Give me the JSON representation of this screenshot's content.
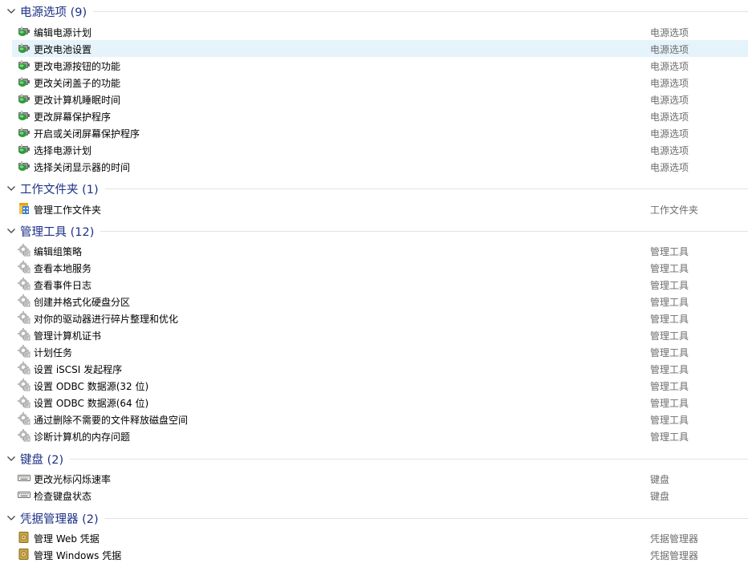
{
  "colors": {
    "header_text": "#1e3287",
    "item_text": "#000000",
    "category_text": "#6d6d6d",
    "selected_bg": "#e5f3fb",
    "divider": "#e3e3e3"
  },
  "groups": [
    {
      "title": "电源选项 (9)",
      "icon": "power-icon",
      "items": [
        {
          "label": "编辑电源计划",
          "category": "电源选项"
        },
        {
          "label": "更改电池设置",
          "category": "电源选项",
          "selected": true
        },
        {
          "label": "更改电源按钮的功能",
          "category": "电源选项"
        },
        {
          "label": "更改关闭盖子的功能",
          "category": "电源选项"
        },
        {
          "label": "更改计算机睡眠时间",
          "category": "电源选项"
        },
        {
          "label": "更改屏幕保护程序",
          "category": "电源选项"
        },
        {
          "label": "开启或关闭屏幕保护程序",
          "category": "电源选项"
        },
        {
          "label": "选择电源计划",
          "category": "电源选项"
        },
        {
          "label": "选择关闭显示器的时间",
          "category": "电源选项"
        }
      ]
    },
    {
      "title": "工作文件夹 (1)",
      "icon": "work-folders-icon",
      "items": [
        {
          "label": "管理工作文件夹",
          "category": "工作文件夹"
        }
      ]
    },
    {
      "title": "管理工具 (12)",
      "icon": "admin-tools-icon",
      "items": [
        {
          "label": "编辑组策略",
          "category": "管理工具"
        },
        {
          "label": "查看本地服务",
          "category": "管理工具"
        },
        {
          "label": "查看事件日志",
          "category": "管理工具"
        },
        {
          "label": "创建并格式化硬盘分区",
          "category": "管理工具"
        },
        {
          "label": "对你的驱动器进行碎片整理和优化",
          "category": "管理工具"
        },
        {
          "label": "管理计算机证书",
          "category": "管理工具"
        },
        {
          "label": "计划任务",
          "category": "管理工具"
        },
        {
          "label": "设置 iSCSI 发起程序",
          "category": "管理工具"
        },
        {
          "label": "设置 ODBC 数据源(32 位)",
          "category": "管理工具"
        },
        {
          "label": "设置 ODBC 数据源(64 位)",
          "category": "管理工具"
        },
        {
          "label": "通过删除不需要的文件释放磁盘空间",
          "category": "管理工具"
        },
        {
          "label": "诊断计算机的内存问题",
          "category": "管理工具"
        }
      ]
    },
    {
      "title": "键盘 (2)",
      "icon": "keyboard-icon",
      "items": [
        {
          "label": "更改光标闪烁速率",
          "category": "键盘"
        },
        {
          "label": "检查键盘状态",
          "category": "键盘"
        }
      ]
    },
    {
      "title": "凭据管理器 (2)",
      "icon": "credential-manager-icon",
      "items": [
        {
          "label": "管理 Web 凭据",
          "category": "凭据管理器"
        },
        {
          "label": "管理 Windows 凭据",
          "category": "凭据管理器"
        }
      ]
    }
  ]
}
